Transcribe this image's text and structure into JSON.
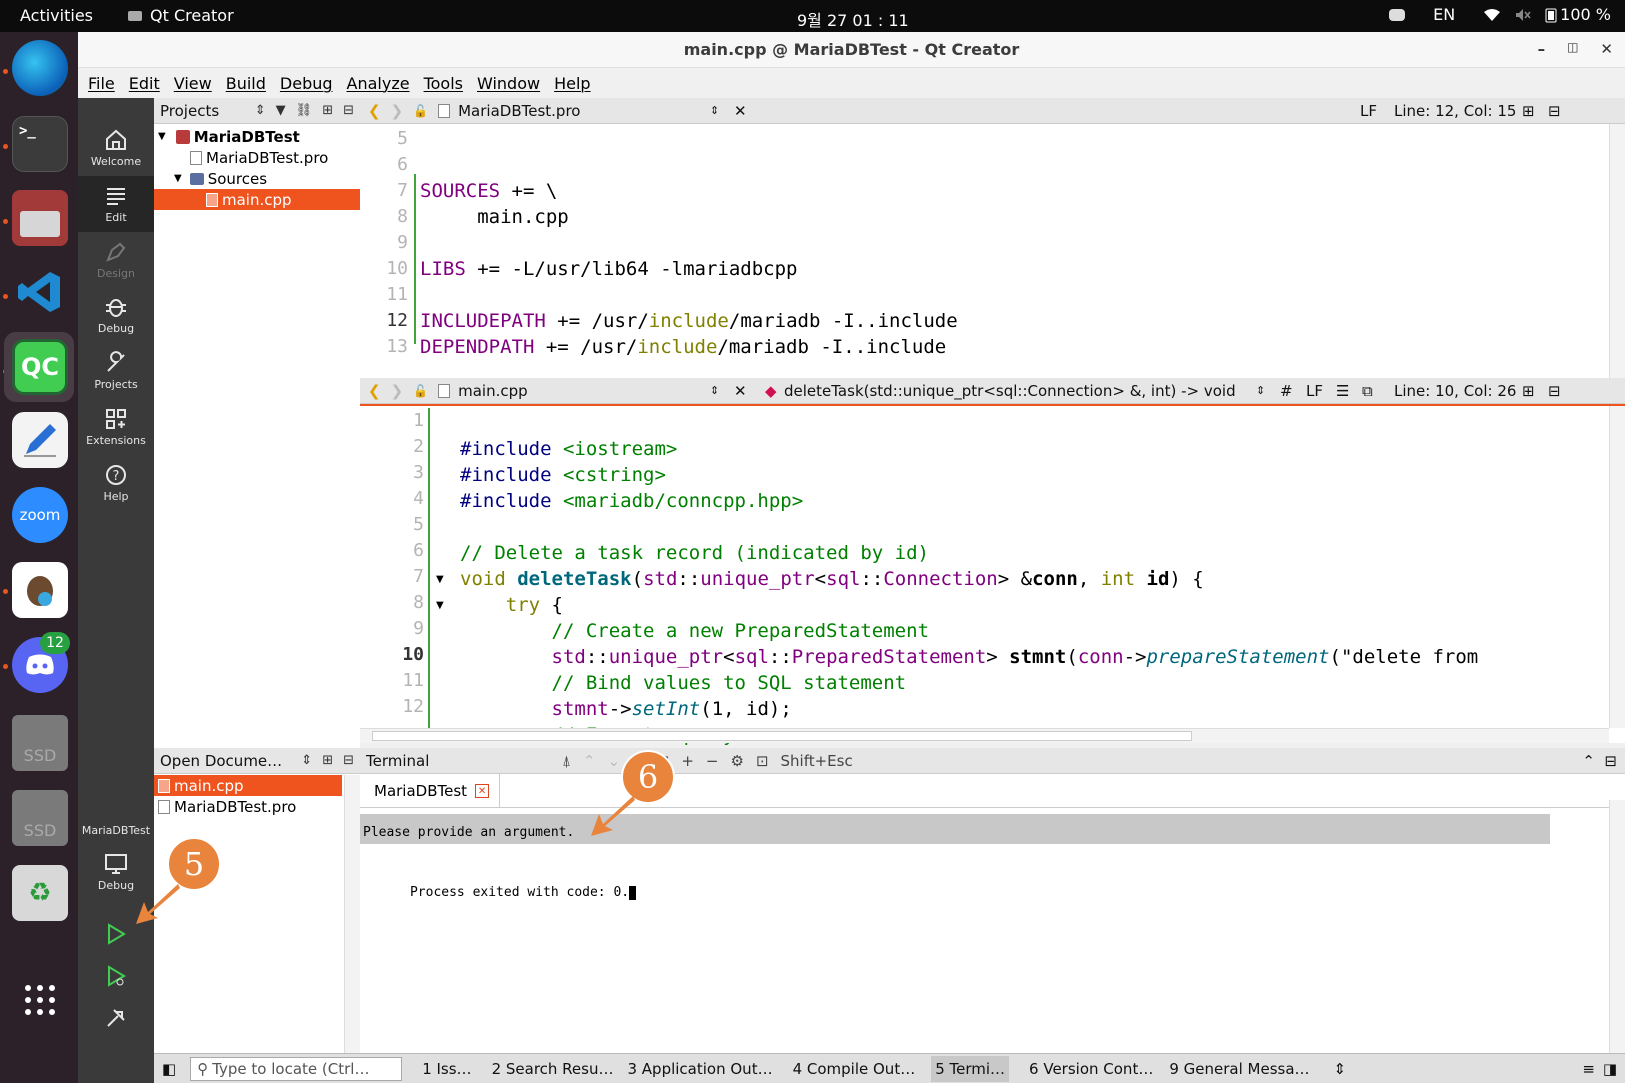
{
  "topbar": {
    "activities": "Activities",
    "app_name": "Qt Creator",
    "clock": "9월 27  01 : 11",
    "lang": "EN",
    "battery": "100 %"
  },
  "dock": {
    "items": [
      "edge-icon",
      "terminal-icon",
      "files-icon",
      "vscode-icon",
      "qtcreator-icon",
      "text-editor-icon",
      "zoom-icon",
      "dbeaver-icon",
      "discord-icon",
      "ssd-drive-icon",
      "ssd-drive-icon",
      "trash-icon",
      "show-apps-icon"
    ],
    "zoom_label": "zoom",
    "qt_label": "QC",
    "discord_badge": "12",
    "ssd_label": "SSD"
  },
  "window": {
    "title": "main.cpp @ MariaDBTest - Qt Creator",
    "menu": [
      "File",
      "Edit",
      "View",
      "Build",
      "Debug",
      "Analyze",
      "Tools",
      "Window",
      "Help"
    ]
  },
  "modes": {
    "welcome": "Welcome",
    "edit": "Edit",
    "design": "Design",
    "debug": "Debug",
    "projects": "Projects",
    "extensions": "Extensions",
    "help": "Help",
    "kit_project": "MariaDBTest",
    "kit_mode": "Debug"
  },
  "projects_pane": {
    "header": "Projects",
    "root": "MariaDBTest",
    "pro_file": "MariaDBTest.pro",
    "sources": "Sources",
    "main_cpp": "main.cpp"
  },
  "editor1": {
    "file": "MariaDBTest.pro",
    "lf": "LF",
    "position": "Line: 12, Col: 15",
    "line_numbers": [
      "5",
      "6",
      "7",
      "8",
      "9",
      "10",
      "11",
      "12",
      "13"
    ]
  },
  "editor2": {
    "file": "main.cpp",
    "symbol": "deleteTask(std::unique_ptr<sql::Connection> &, int) -> void",
    "hash": "#",
    "lf": "LF",
    "position": "Line: 10, Col: 26",
    "line_numbers": [
      "1",
      "2",
      "3",
      "4",
      "5",
      "6",
      "7",
      "8",
      "9",
      "10",
      "11",
      "12"
    ]
  },
  "open_documents": {
    "header": "Open Docume…",
    "items": [
      "main.cpp",
      "MariaDBTest.pro"
    ]
  },
  "terminal": {
    "header": "Terminal",
    "shortcut": "Shift+Esc",
    "tab": "MariaDBTest",
    "line1": "Please provide an argument.",
    "line2": "Process exited with code: 0."
  },
  "statusbar": {
    "locator": "Type to locate (Ctrl…",
    "tabs": [
      "1  Iss…",
      "2  Search Resu…",
      "3  Application Out…",
      "4  Compile Out…",
      "5  Termi…",
      "6  Version Cont…",
      "9  General Messa…"
    ]
  },
  "annotations": {
    "five": "5",
    "six": "6"
  },
  "colors": {
    "accent": "#f0541e",
    "callout": "#e8843c"
  }
}
